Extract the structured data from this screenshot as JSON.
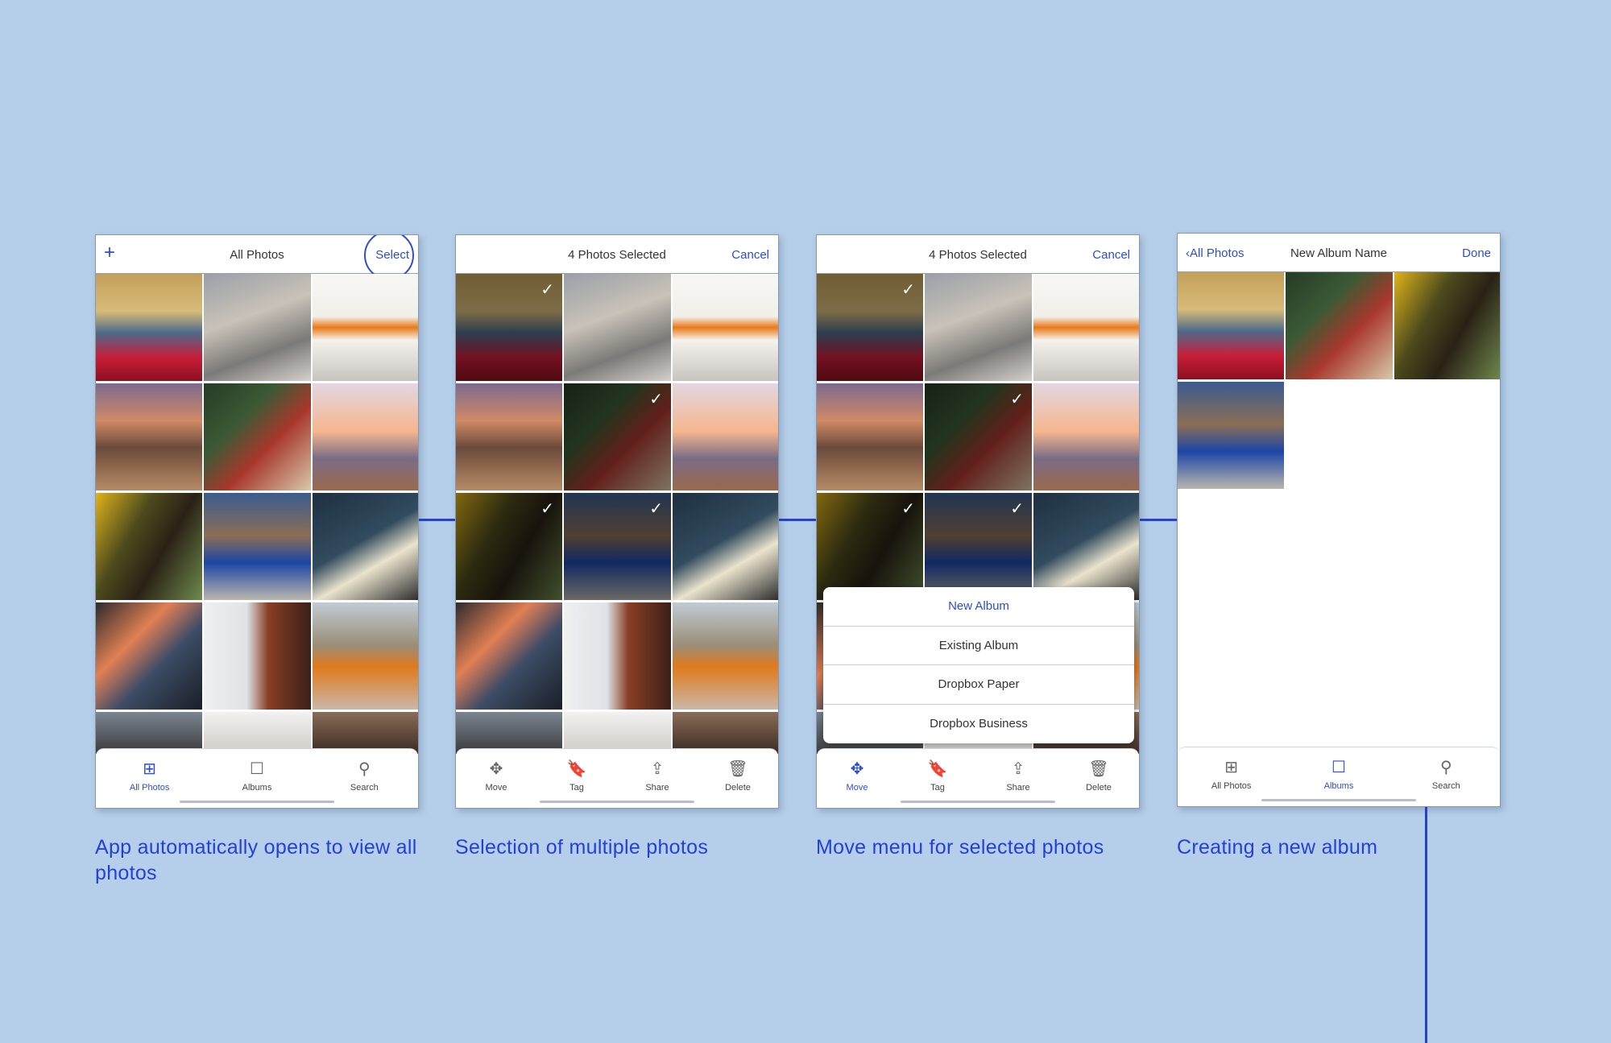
{
  "colors": {
    "background": "#b5cfea",
    "accent": "#2d4dd2",
    "caption": "#2440d8"
  },
  "screens": [
    {
      "header": {
        "left_icon": "plus-icon",
        "left_glyph": "+",
        "title": "All Photos",
        "right": "Select"
      },
      "tabs": [
        {
          "label": "All Photos",
          "icon": "grid-icon",
          "glyph": "⊞",
          "active": true
        },
        {
          "label": "Albums",
          "icon": "album-icon",
          "glyph": "☐",
          "active": false
        },
        {
          "label": "Search",
          "icon": "search-icon",
          "glyph": "⚲",
          "active": false
        }
      ],
      "caption": "App automatically opens to view all photos"
    },
    {
      "header": {
        "title": "4 Photos Selected",
        "right": "Cancel"
      },
      "check_glyph": "✓",
      "tabs": [
        {
          "label": "Move",
          "icon": "move-icon",
          "glyph": "✥",
          "active": false
        },
        {
          "label": "Tag",
          "icon": "bookmark-icon",
          "glyph": "🔖",
          "active": false
        },
        {
          "label": "Share",
          "icon": "share-icon",
          "glyph": "⇪",
          "active": false
        },
        {
          "label": "Delete",
          "icon": "trash-icon",
          "glyph": "🗑",
          "active": false
        }
      ],
      "caption": "Selection of multiple photos"
    },
    {
      "header": {
        "title": "4 Photos Selected",
        "right": "Cancel"
      },
      "menu": [
        "New Album",
        "Existing Album",
        "Dropbox Paper",
        "Dropbox Business"
      ],
      "tabs": [
        {
          "label": "Move",
          "icon": "move-icon",
          "glyph": "✥",
          "active": true
        },
        {
          "label": "Tag",
          "icon": "bookmark-icon",
          "glyph": "🔖",
          "active": false
        },
        {
          "label": "Share",
          "icon": "share-icon",
          "glyph": "⇪",
          "active": false
        },
        {
          "label": "Delete",
          "icon": "trash-icon",
          "glyph": "🗑",
          "active": false
        }
      ],
      "caption": "Move menu for selected photos"
    },
    {
      "header": {
        "back": "‹All Photos",
        "title": "New Album Name",
        "right": "Done"
      },
      "tabs": [
        {
          "label": "All Photos",
          "icon": "grid-icon",
          "glyph": "⊞",
          "active": false
        },
        {
          "label": "Albums",
          "icon": "album-icon",
          "glyph": "☐",
          "active": true
        },
        {
          "label": "Search",
          "icon": "search-icon",
          "glyph": "⚲",
          "active": false
        }
      ],
      "caption": "Creating a new album"
    }
  ]
}
